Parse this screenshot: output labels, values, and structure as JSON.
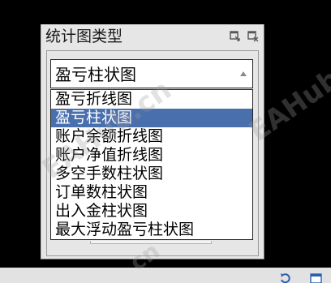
{
  "dialog": {
    "title": "统计图类型",
    "buttons": [
      {
        "name": "restore",
        "icon": "window-restore-icon"
      },
      {
        "name": "close",
        "icon": "close-icon"
      }
    ]
  },
  "combo": {
    "selected": "盈亏柱状图",
    "arrow_icon": "triangle-up-icon"
  },
  "dropdown": {
    "items": [
      {
        "label": "盈亏折线图",
        "selected": false
      },
      {
        "label": "盈亏柱状图",
        "selected": true
      },
      {
        "label": "账户余额折线图",
        "selected": false
      },
      {
        "label": "账户净值折线图",
        "selected": false
      },
      {
        "label": "多空手数柱状图",
        "selected": false
      },
      {
        "label": "订单数柱状图",
        "selected": false
      },
      {
        "label": "出入金柱状图",
        "selected": false
      },
      {
        "label": "最大浮动盈亏柱状图",
        "selected": false
      }
    ],
    "highlight_color": "#4a6fad"
  },
  "watermarks": {
    "left": "EAHub.cn",
    "right": "EAHub",
    "bottom": "cn"
  },
  "taskbar": {
    "icons": [
      "refresh-icon",
      "window-icon"
    ]
  }
}
